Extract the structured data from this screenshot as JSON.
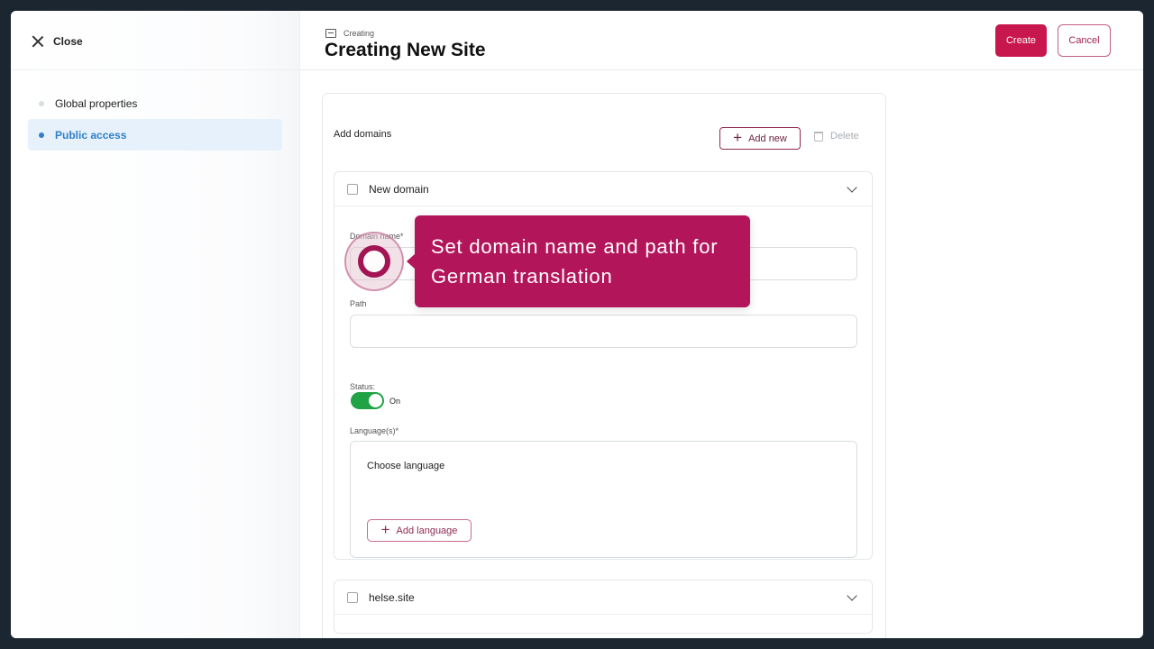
{
  "sidebar": {
    "close_label": "Close",
    "items": [
      {
        "label": "Global properties"
      },
      {
        "label": "Public access"
      }
    ]
  },
  "header": {
    "breadcrumb": "Creating",
    "title": "Creating New Site",
    "create_label": "Create",
    "cancel_label": "Cancel"
  },
  "domains": {
    "section_title": "Add domains",
    "add_new_label": "Add new",
    "delete_label": "Delete",
    "items": [
      {
        "name": "New domain",
        "domain_name_label": "Domain name*",
        "domain_name_value": "",
        "path_label": "Path",
        "path_value": "",
        "status_label": "Status:",
        "status_value": "On",
        "languages_label": "Language(s)*",
        "choose_language": "Choose language",
        "add_language_label": "Add language"
      },
      {
        "name": "helse.site"
      }
    ]
  },
  "tooltip": {
    "text": "Set domain name and path for German translation"
  },
  "colors": {
    "brand": "#c8164f",
    "tooltip_bg": "#b3155a",
    "active_nav": "#2f7fc9",
    "toggle_on": "#21a345"
  }
}
